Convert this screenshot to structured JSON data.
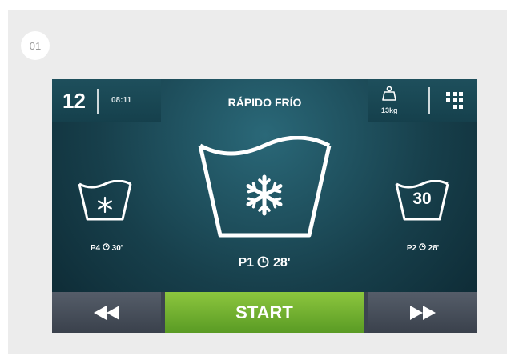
{
  "step_badge": "01",
  "header": {
    "program_number": "12",
    "time": "08:11",
    "title": "RÁPIDO FRÍO",
    "weight": "13kg"
  },
  "programs": {
    "left": {
      "label": "P4",
      "duration": "30'",
      "icon": "snowflake-icon"
    },
    "center": {
      "label": "P1",
      "duration": "28'",
      "icon": "snowflake-icon"
    },
    "right": {
      "label": "P2",
      "duration": "28'",
      "icon_text": "30"
    }
  },
  "controls": {
    "start_label": "START",
    "prev_icon": "rewind-icon",
    "next_icon": "fast-forward-icon"
  },
  "colors": {
    "screen_bg": "#173f4b",
    "start_green": "#7ab83a",
    "nav_gray": "#4a525d"
  }
}
